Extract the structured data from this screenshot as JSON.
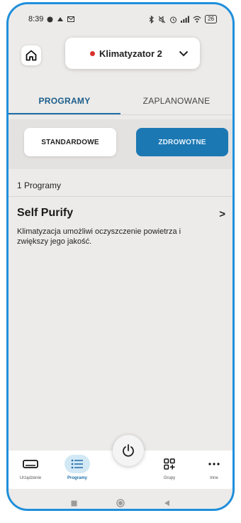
{
  "status": {
    "time": "8:39",
    "battery": "26"
  },
  "header": {
    "device_name": "Klimatyzator 2"
  },
  "tabs": [
    {
      "label": "PROGRAMY"
    },
    {
      "label": "ZAPLANOWANE"
    }
  ],
  "segments": {
    "standard": "STANDARDOWE",
    "health": "ZDROWOTNE"
  },
  "programs": {
    "count_label": "1 Programy",
    "items": [
      {
        "title": "Self Purify",
        "description": "Klimatyzacja umożliwi oczyszczenie powietrza i zwiększy jego jakość."
      }
    ]
  },
  "bottom_nav": [
    {
      "label": "Urządzenie",
      "icon": "device-icon"
    },
    {
      "label": "Programy",
      "icon": "list-icon"
    },
    {
      "label": "Grupy",
      "icon": "groups-icon"
    },
    {
      "label": "Inne",
      "icon": "more-icon"
    }
  ],
  "colors": {
    "accent": "#1f6ea8",
    "frame": "#1f8fdc",
    "status_dot": "#d9302b"
  }
}
